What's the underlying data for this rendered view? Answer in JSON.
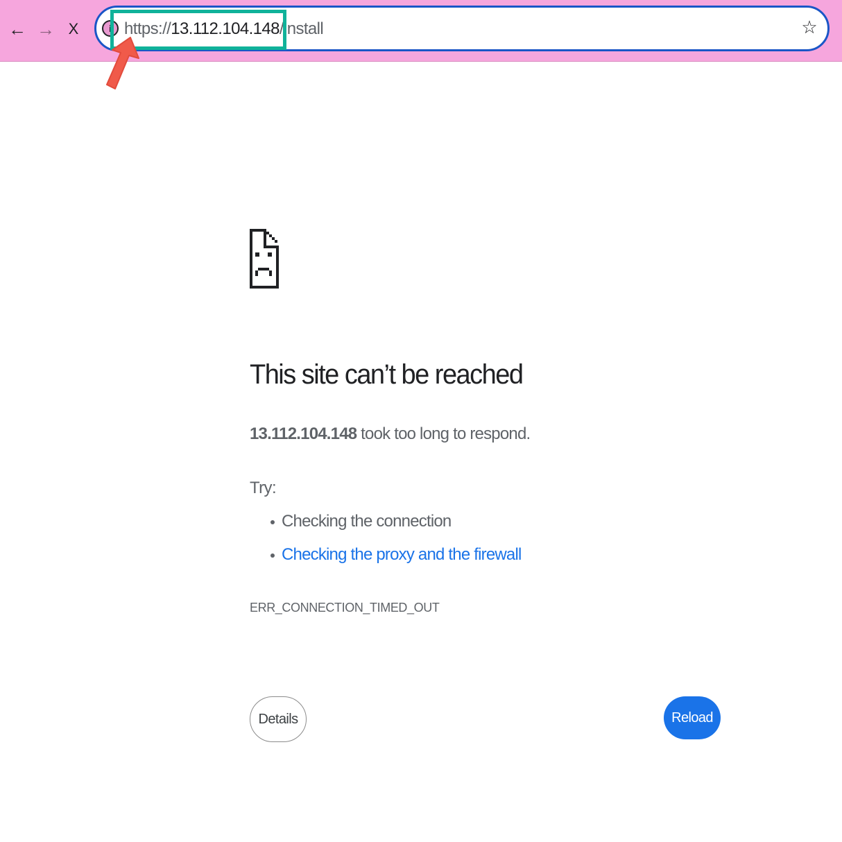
{
  "browser": {
    "nav": {
      "back_icon": "←",
      "forward_icon": "→",
      "stop_icon": "X"
    },
    "omnibox": {
      "url_scheme": "https://",
      "url_host": "13.112.104.148",
      "url_path": "/install",
      "info_icon": "i",
      "bookmark_icon": "☆"
    }
  },
  "error_page": {
    "title": "This site can’t be reached",
    "host": "13.112.104.148",
    "message": " took too long to respond.",
    "try_label": "Try:",
    "suggestions": [
      "Checking the connection",
      "Checking the proxy and the firewall"
    ],
    "error_code": "ERR_CONNECTION_TIMED_OUT",
    "details_label": "Details",
    "reload_label": "Reload"
  },
  "colors": {
    "toolbar": "#f6a6dd",
    "omnibox_border": "#1a56c7",
    "annotation_box": "#10b29a",
    "annotation_arrow": "#f05a4a",
    "link": "#1a73e8",
    "reload_button": "#1a73e8"
  }
}
